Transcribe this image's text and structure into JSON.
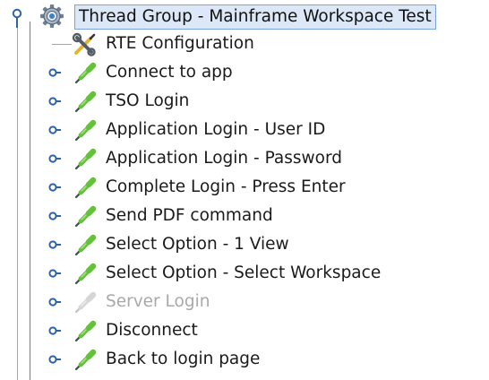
{
  "tree": {
    "root": {
      "label": "Thread Group - Mainframe Workspace Test",
      "icon": "gear-icon",
      "expanded": true,
      "selected": true
    },
    "children": [
      {
        "label": "RTE Configuration",
        "icon": "wrench-screwdriver-icon",
        "has_handle": false,
        "enabled": true
      },
      {
        "label": "Connect to app",
        "icon": "pipette-sampler-icon",
        "has_handle": true,
        "enabled": true
      },
      {
        "label": "TSO Login",
        "icon": "pipette-sampler-icon",
        "has_handle": true,
        "enabled": true
      },
      {
        "label": "Application Login - User ID",
        "icon": "pipette-sampler-icon",
        "has_handle": true,
        "enabled": true
      },
      {
        "label": "Application Login - Password",
        "icon": "pipette-sampler-icon",
        "has_handle": true,
        "enabled": true
      },
      {
        "label": "Complete Login - Press Enter",
        "icon": "pipette-sampler-icon",
        "has_handle": true,
        "enabled": true
      },
      {
        "label": "Send PDF command",
        "icon": "pipette-sampler-icon",
        "has_handle": true,
        "enabled": true
      },
      {
        "label": "Select Option - 1 View",
        "icon": "pipette-sampler-icon",
        "has_handle": true,
        "enabled": true
      },
      {
        "label": "Select Option - Select Workspace",
        "icon": "pipette-sampler-icon",
        "has_handle": true,
        "enabled": true
      },
      {
        "label": "Server Login",
        "icon": "pipette-sampler-icon",
        "has_handle": true,
        "enabled": false
      },
      {
        "label": "Disconnect",
        "icon": "pipette-sampler-icon",
        "has_handle": true,
        "enabled": true
      },
      {
        "label": "Back to login page",
        "icon": "pipette-sampler-icon",
        "has_handle": true,
        "enabled": true
      }
    ]
  },
  "colors": {
    "selection_bg": "#dce8f8",
    "selection_border": "#7ba4d6",
    "handle": "#2f63a8",
    "tree_line": "#9aa8bd",
    "disabled_text": "#a9a9a9",
    "sampler_green": "#63c13b"
  }
}
